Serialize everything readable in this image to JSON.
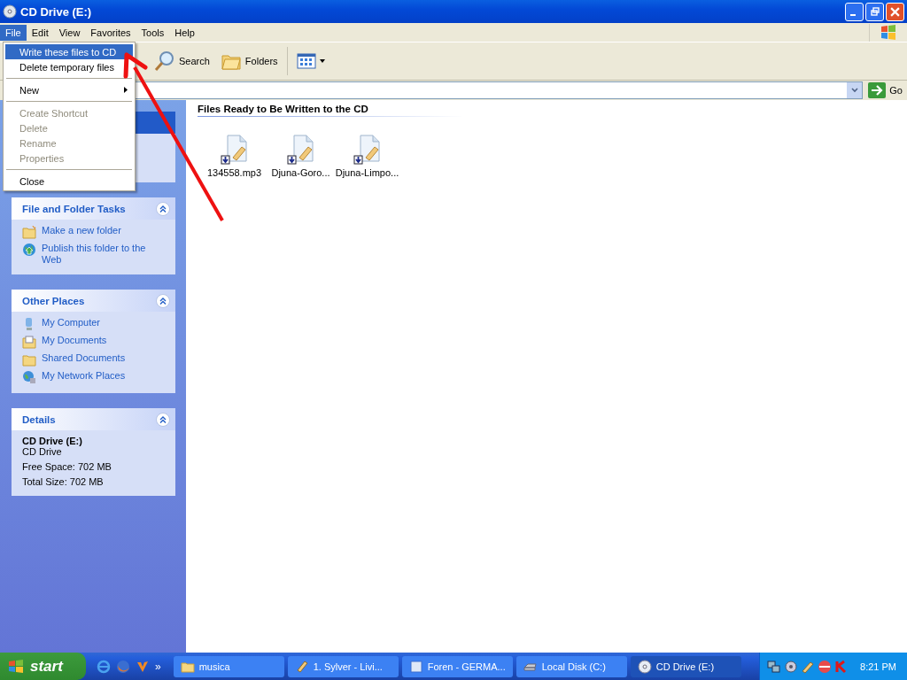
{
  "window": {
    "title": "CD Drive (E:)"
  },
  "menu_bar": [
    {
      "label": "File",
      "selected": true
    },
    {
      "label": "Edit",
      "selected": false
    },
    {
      "label": "View",
      "selected": false
    },
    {
      "label": "Favorites",
      "selected": false
    },
    {
      "label": "Tools",
      "selected": false
    },
    {
      "label": "Help",
      "selected": false
    }
  ],
  "file_menu": [
    {
      "kind": "item",
      "label": "Write these files to CD",
      "selected": true,
      "disabled": false
    },
    {
      "kind": "item",
      "label": "Delete temporary files",
      "selected": false,
      "disabled": false
    },
    {
      "kind": "separator"
    },
    {
      "kind": "submenu",
      "label": "New",
      "selected": false,
      "disabled": false
    },
    {
      "kind": "separator"
    },
    {
      "kind": "item",
      "label": "Create Shortcut",
      "selected": false,
      "disabled": true
    },
    {
      "kind": "item",
      "label": "Delete",
      "selected": false,
      "disabled": true
    },
    {
      "kind": "item",
      "label": "Rename",
      "selected": false,
      "disabled": true
    },
    {
      "kind": "item",
      "label": "Properties",
      "selected": false,
      "disabled": true
    },
    {
      "kind": "separator"
    },
    {
      "kind": "item",
      "label": "Close",
      "selected": false,
      "disabled": false
    }
  ],
  "toolbar": [
    {
      "kind": "search",
      "label": "Search"
    },
    {
      "kind": "folders",
      "label": "Folders"
    }
  ],
  "address_bar": {
    "go_label": "Go"
  },
  "sidebar": {
    "panels": [
      {
        "title": "File and Folder Tasks",
        "items": [
          {
            "kind": "folder-new",
            "label": "Make a new folder"
          },
          {
            "kind": "globe",
            "label": "Publish this folder to the Web"
          }
        ]
      },
      {
        "title": "Other Places",
        "items": [
          {
            "kind": "computer",
            "label": "My Computer"
          },
          {
            "kind": "documents",
            "label": "My Documents"
          },
          {
            "kind": "folder",
            "label": "Shared Documents"
          },
          {
            "kind": "network",
            "label": "My Network Places"
          }
        ]
      }
    ],
    "details": {
      "title": "Details",
      "name": "CD Drive (E:)",
      "type": "CD Drive",
      "lines": [
        "Free Space: 702 MB",
        "Total Size: 702 MB"
      ]
    }
  },
  "files_section": {
    "title": "Files Ready to Be Written to the CD",
    "files": [
      {
        "name": "134558.mp3"
      },
      {
        "name": "Djuna-Goro..."
      },
      {
        "name": "Djuna-Limpo..."
      }
    ]
  },
  "taskbar": {
    "start_label": "start",
    "chevron": "»",
    "tasks": [
      {
        "kind": "folder",
        "label": "musica",
        "selected": false
      },
      {
        "kind": "media",
        "label": "1. Sylver - Livi...",
        "selected": false
      },
      {
        "kind": "browser",
        "label": "Foren - GERMA...",
        "selected": false
      },
      {
        "kind": "drive",
        "label": "Local Disk (C:)",
        "selected": false
      },
      {
        "kind": "cd",
        "label": "CD Drive (E:)",
        "selected": true
      }
    ],
    "clock": "8:21 PM"
  }
}
